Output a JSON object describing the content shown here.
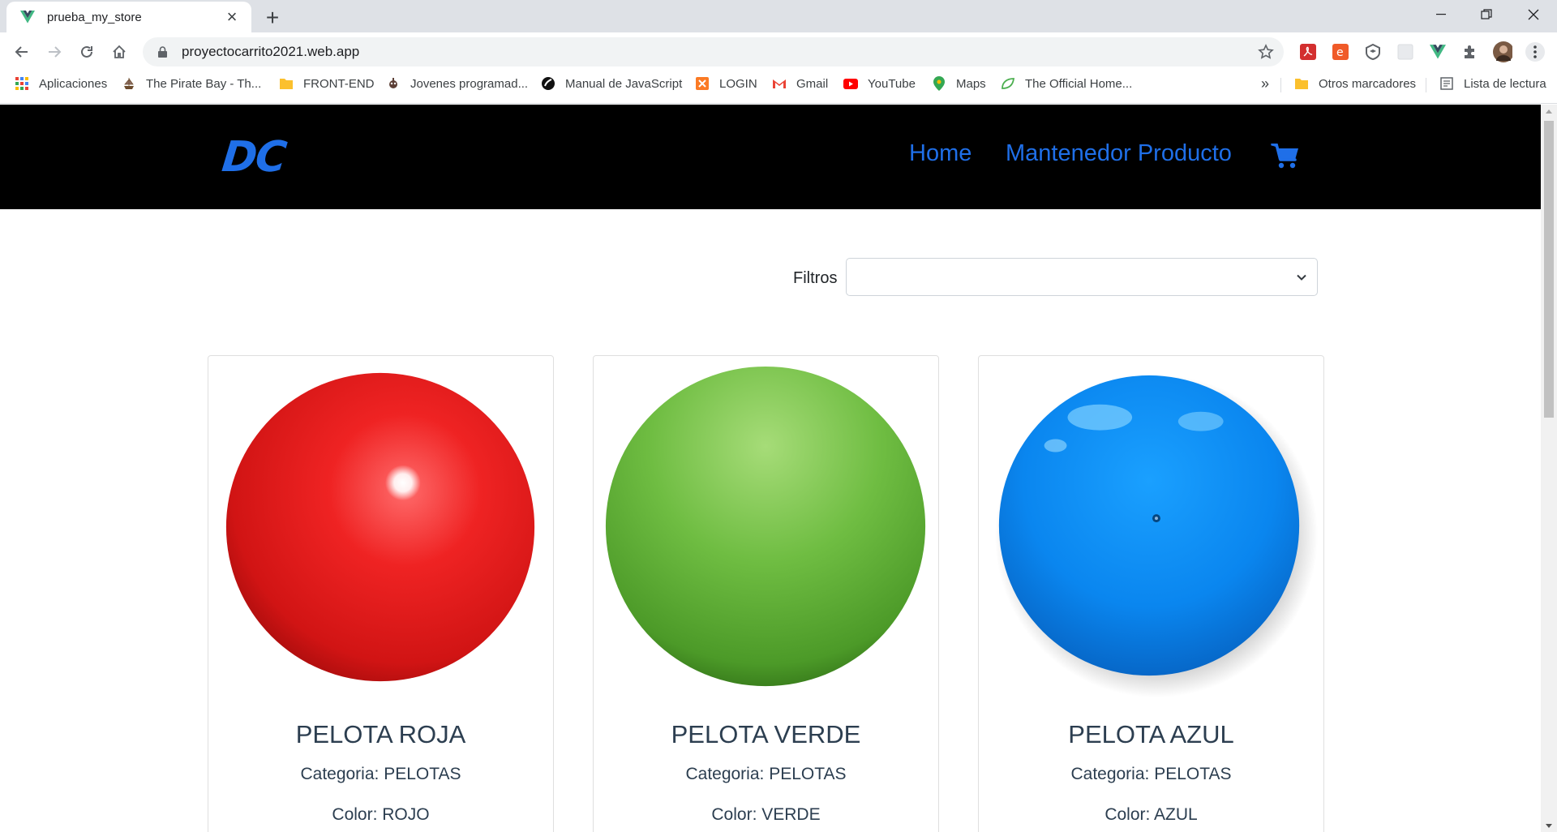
{
  "browser": {
    "tab_title": "prueba_my_store",
    "url": "proyectocarrito2021.web.app"
  },
  "bookmarks": {
    "apps": "Aplicaciones",
    "items": [
      "The Pirate Bay - Th...",
      "FRONT-END",
      "Jovenes programad...",
      "Manual de JavaScript",
      "LOGIN",
      "Gmail",
      "YouTube",
      "Maps",
      "The Official Home..."
    ],
    "overflow": "»",
    "other": "Otros marcadores",
    "reading_list": "Lista de lectura"
  },
  "navbar": {
    "logo": "DC",
    "links": [
      "Home",
      "Mantenedor Producto"
    ],
    "brand_color": "#1f6fe8"
  },
  "filters": {
    "label": "Filtros",
    "selected": ""
  },
  "products": [
    {
      "name": "PELOTA ROJA",
      "category": "Categoria: PELOTAS",
      "color": "Color: ROJO",
      "ball": "red"
    },
    {
      "name": "PELOTA VERDE",
      "category": "Categoria: PELOTAS",
      "color": "Color: VERDE",
      "ball": "green"
    },
    {
      "name": "PELOTA AZUL",
      "category": "Categoria: PELOTAS",
      "color": "Color: AZUL",
      "ball": "blue"
    }
  ]
}
